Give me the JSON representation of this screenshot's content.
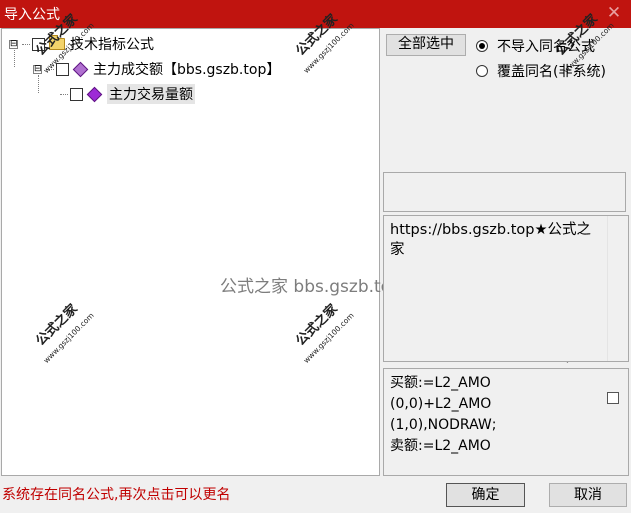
{
  "window": {
    "title": "导入公式",
    "close_glyph": "✕"
  },
  "tree": {
    "root": {
      "expander": "⊟",
      "label": "技术指标公式"
    },
    "group": {
      "expander": "⊟",
      "label": "主力成交额【bbs.gszb.top】"
    },
    "leaf": {
      "label": "主力交易量额"
    }
  },
  "watermark": {
    "stamp_text": "公式之家",
    "stamp_url": "www.gszj100.com",
    "center_text": "公式之家 bbs.gszb.top"
  },
  "options": {
    "select_all_label": "全部选中",
    "radio_skip_label": "不导入同名公式",
    "radio_overwrite_label": "覆盖同名(非系统)",
    "selected_radio": "skip"
  },
  "description": {
    "text": "https://bbs.gszb.top★公式之家"
  },
  "code": {
    "lines": [
      "买额:=L2_AMO",
      "(0,0)+L2_AMO",
      "(1,0),NODRAW;",
      "卖额:=L2_AMO"
    ],
    "checked": false
  },
  "status": {
    "message": "系统存在同名公式,再次点击可以更名",
    "color": "#c00000"
  },
  "buttons": {
    "ok_label": "确定",
    "cancel_label": "取消"
  },
  "colors": {
    "titlebar": "#c0140f",
    "folder": "#f3d36b",
    "formula_icon": "#9d2bd6"
  }
}
